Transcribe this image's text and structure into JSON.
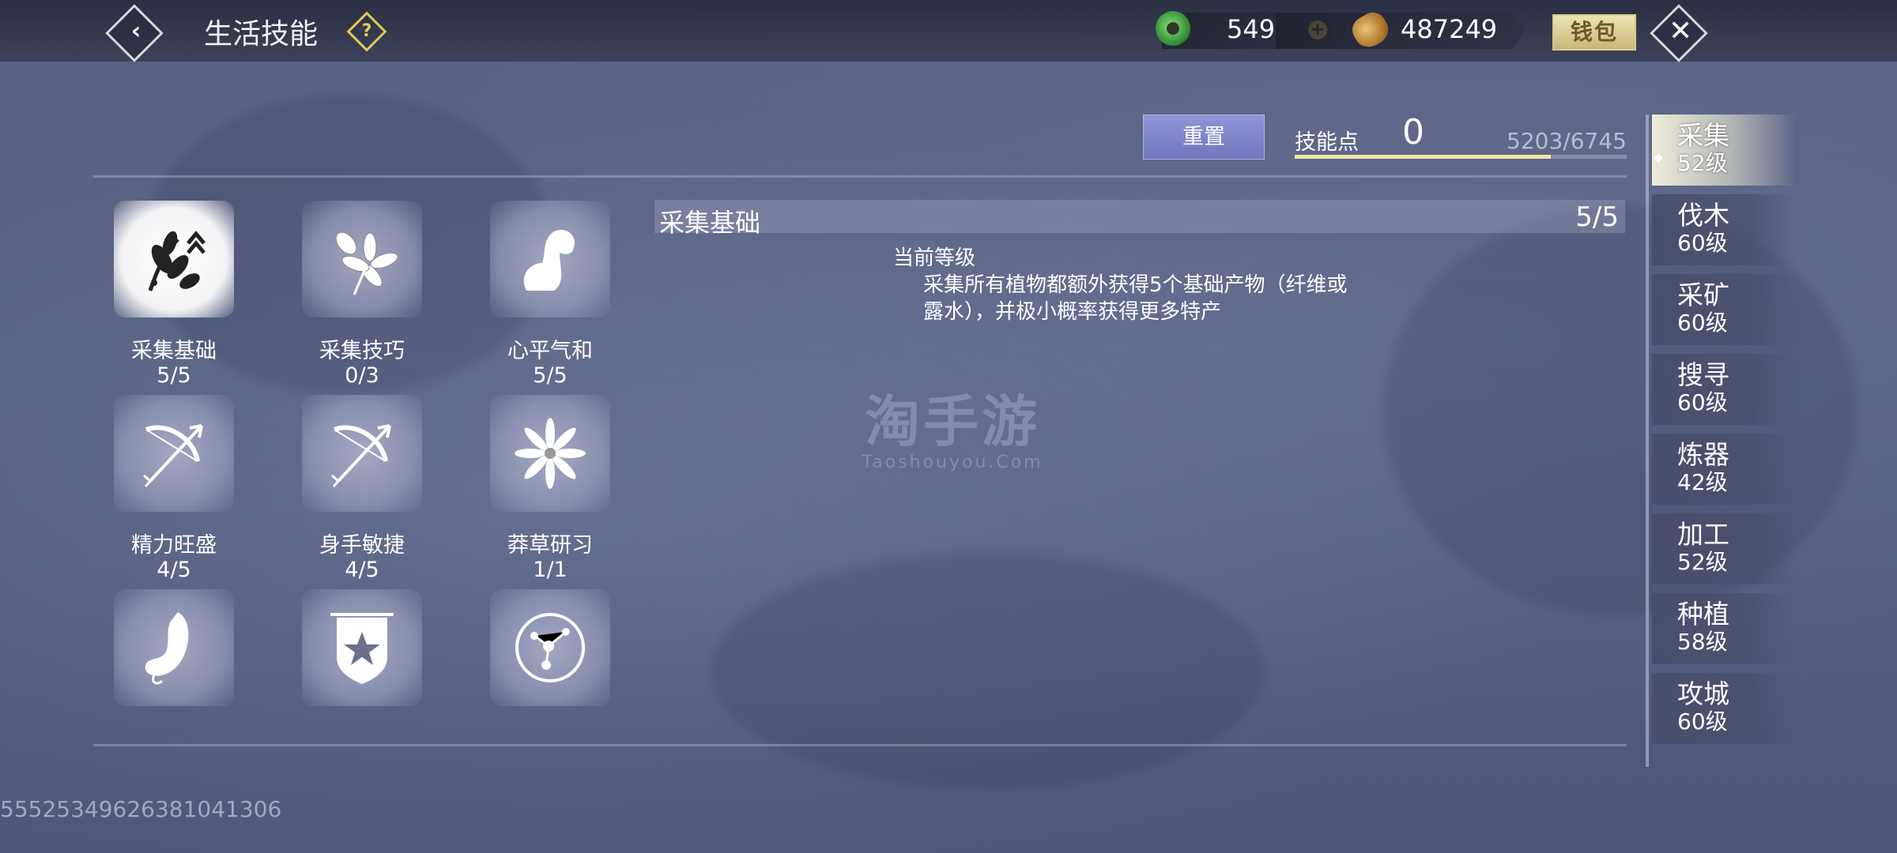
{
  "header": {
    "title": "生活技能",
    "back_icon": "chevron-left-icon",
    "help_icon": "question-icon",
    "jade_value": "549",
    "coin_value": "487249",
    "wallet_label": "钱包",
    "close_icon": "close-icon"
  },
  "skill_points": {
    "reset_label": "重置",
    "label": "技能点",
    "value": "0",
    "xp_text": "5203/6745",
    "xp_progress": 0.7714
  },
  "skills": [
    {
      "name": "采集基础",
      "level": "5/5",
      "icon": "plant-leaves-icon"
    },
    {
      "name": "采集技巧",
      "level": "0/3",
      "icon": "flower-icon"
    },
    {
      "name": "心平气和",
      "level": "5/5",
      "icon": "muscle-arm-icon"
    },
    {
      "name": "精力旺盛",
      "level": "4/5",
      "icon": "bow-arrow-icon"
    },
    {
      "name": "身手敏捷",
      "level": "4/5",
      "icon": "bow-arrow-icon"
    },
    {
      "name": "莽草研习",
      "level": "1/1",
      "icon": "herb-flower-icon"
    },
    {
      "name": "",
      "level": "",
      "icon": "stomach-icon"
    },
    {
      "name": "",
      "level": "",
      "icon": "star-banner-icon"
    },
    {
      "name": "",
      "level": "",
      "icon": "constellation-icon"
    }
  ],
  "detail": {
    "name": "采集基础",
    "level": "5/5",
    "current_level_label": "当前等级",
    "description": "采集所有植物都额外获得5个基础产物（纤维或露水），并极小概率获得更多特产"
  },
  "tabs": [
    {
      "name": "采集",
      "level": "52级",
      "active": true
    },
    {
      "name": "伐木",
      "level": "60级"
    },
    {
      "name": "采矿",
      "level": "60级"
    },
    {
      "name": "搜寻",
      "level": "60级"
    },
    {
      "name": "炼器",
      "level": "42级"
    },
    {
      "name": "加工",
      "level": "52级"
    },
    {
      "name": "种植",
      "level": "58级"
    },
    {
      "name": "攻城",
      "level": "60级"
    }
  ],
  "watermark": {
    "cn": "淘手游",
    "en": "Taoshouyou.Com"
  },
  "uid": "5552534962638104130​6"
}
